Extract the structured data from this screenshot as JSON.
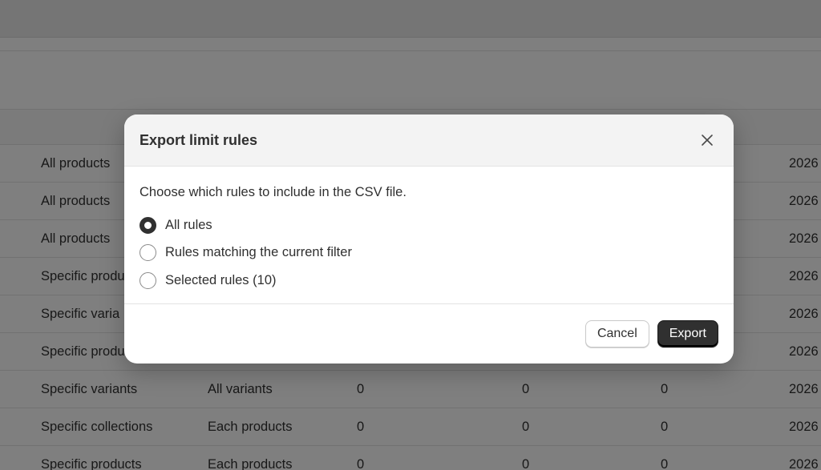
{
  "table": {
    "rows": [
      {
        "type": "All products",
        "scope": "",
        "min": "",
        "max": "",
        "step": "",
        "date": "2026"
      },
      {
        "type": "All products",
        "scope": "",
        "min": "",
        "max": "",
        "step": "",
        "date": "2026"
      },
      {
        "type": "All products",
        "scope": "",
        "min": "",
        "max": "",
        "step": "",
        "date": "2026"
      },
      {
        "type": "Specific produ",
        "scope": "",
        "min": "",
        "max": "",
        "step": "",
        "date": "2026"
      },
      {
        "type": "Specific varia",
        "scope": "",
        "min": "",
        "max": "",
        "step": "",
        "date": "2026"
      },
      {
        "type": "Specific produ",
        "scope": "",
        "min": "",
        "max": "",
        "step": "",
        "date": "2026"
      },
      {
        "type": "Specific variants",
        "scope": "All variants",
        "min": "0",
        "max": "0",
        "step": "0",
        "date": "2026"
      },
      {
        "type": "Specific collections",
        "scope": "Each products",
        "min": "0",
        "max": "0",
        "step": "0",
        "date": "2026"
      },
      {
        "type": "Specific products",
        "scope": "Each products",
        "min": "0",
        "max": "0",
        "step": "0",
        "date": "2026"
      }
    ]
  },
  "modal": {
    "title": "Export limit rules",
    "prompt": "Choose which rules to include in the CSV file.",
    "options": [
      {
        "label": "All rules",
        "checked": true
      },
      {
        "label": "Rules matching the current filter",
        "checked": false
      },
      {
        "label": "Selected rules (10)",
        "checked": false
      }
    ],
    "cancel_label": "Cancel",
    "export_label": "Export"
  }
}
